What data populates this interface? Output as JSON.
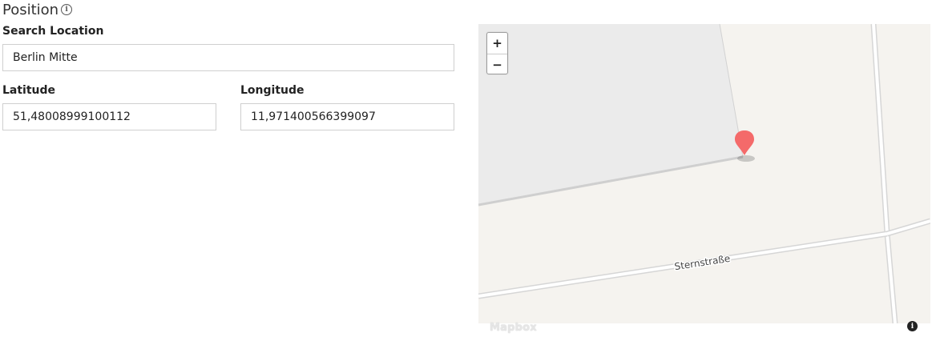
{
  "section": {
    "title": "Position",
    "info_icon": "info-circle-icon"
  },
  "search": {
    "label": "Search Location",
    "value": "Berlin Mitte"
  },
  "latitude": {
    "label": "Latitude",
    "value": "51,48008999100112"
  },
  "longitude": {
    "label": "Longitude",
    "value": "11,971400566399097"
  },
  "map": {
    "street_label": "Sternstraße",
    "zoom_in": "+",
    "zoom_out": "−",
    "attribution_logo": "Mapbox",
    "attribution_icon": "i",
    "marker_color": "#f46a6a"
  }
}
